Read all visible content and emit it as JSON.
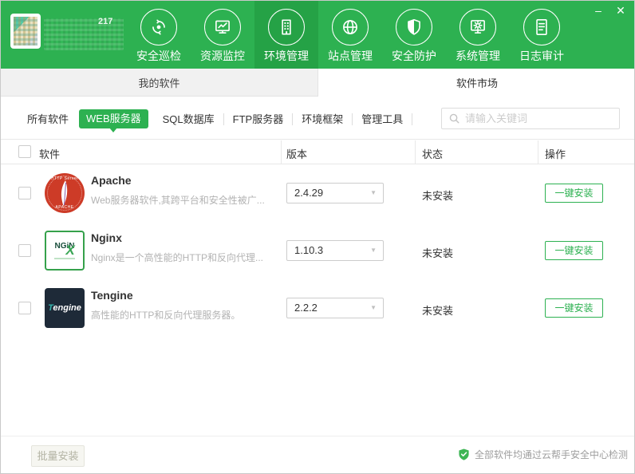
{
  "window": {
    "minimize_glyph": "–",
    "close_glyph": "✕"
  },
  "header": {
    "redacted_fragment": "217",
    "nav": [
      {
        "label": "安全巡检",
        "icon": "security-scan-icon",
        "active": false
      },
      {
        "label": "资源监控",
        "icon": "resource-monitor-icon",
        "active": false
      },
      {
        "label": "环境管理",
        "icon": "environment-manage-icon",
        "active": true
      },
      {
        "label": "站点管理",
        "icon": "site-manage-icon",
        "active": false
      },
      {
        "label": "安全防护",
        "icon": "security-protect-icon",
        "active": false
      },
      {
        "label": "系统管理",
        "icon": "system-manage-icon",
        "active": false
      },
      {
        "label": "日志审计",
        "icon": "log-audit-icon",
        "active": false
      }
    ]
  },
  "tabs": {
    "my_software": "我的软件",
    "software_market": "软件市场"
  },
  "filters": {
    "items": [
      "所有软件",
      "WEB服务器",
      "SQL数据库",
      "FTP服务器",
      "环境框架",
      "管理工具"
    ],
    "selected": "WEB服务器"
  },
  "search": {
    "placeholder": "请输入关键词"
  },
  "table": {
    "columns": {
      "software": "软件",
      "version": "版本",
      "status": "状态",
      "action": "操作"
    },
    "rows": [
      {
        "name": "Apache",
        "description": "Web服务器软件,其跨平台和安全性被广...",
        "version": "2.4.29",
        "status": "未安装",
        "action": "一键安装"
      },
      {
        "name": "Nginx",
        "description": "Nginx是一个高性能的HTTP和反向代理...",
        "version": "1.10.3",
        "status": "未安装",
        "action": "一键安装"
      },
      {
        "name": "Tengine",
        "description": "高性能的HTTP和反向代理服务器。",
        "version": "2.2.2",
        "status": "未安装",
        "action": "一键安装"
      }
    ]
  },
  "logos": {
    "apache": {
      "ring_top": "HTTP Server",
      "ring_bottom": "APACHE"
    },
    "nginx": {
      "text": "NGiN",
      "x": "X"
    },
    "tengine": {
      "t": "T",
      "rest": "engine"
    }
  },
  "footer": {
    "batch_install_label": "批量安装",
    "security_note": "全部软件均通过云帮手安全中心检测"
  },
  "glyphs": {
    "caret_down": "▼"
  },
  "colors": {
    "brand_green": "#2db151",
    "active_nav_green": "#25a246",
    "tengine_navy": "#1e2a38",
    "apache_red": "#cd3b27"
  }
}
